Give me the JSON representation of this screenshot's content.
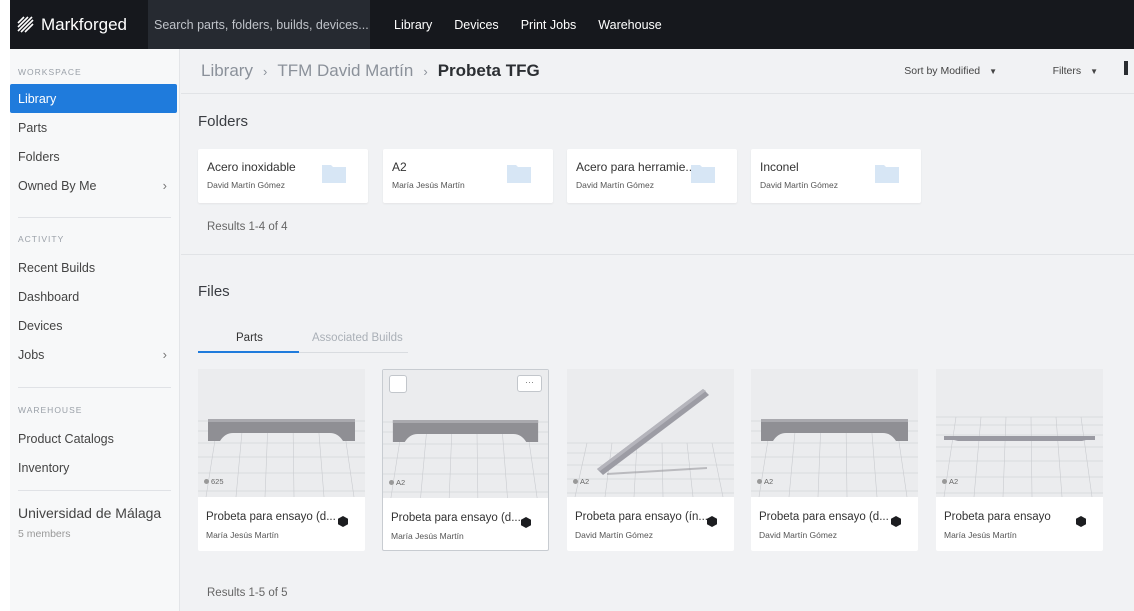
{
  "header": {
    "brand": "Markforged",
    "search_placeholder": "Search parts, folders, builds, devices...",
    "nav": [
      "Library",
      "Devices",
      "Print Jobs",
      "Warehouse"
    ]
  },
  "sidebar": {
    "workspace_heading": "WORKSPACE",
    "workspace_items": [
      "Library",
      "Parts",
      "Folders",
      "Owned By Me"
    ],
    "activity_heading": "ACTIVITY",
    "activity_items": [
      "Recent Builds",
      "Dashboard",
      "Devices",
      "Jobs"
    ],
    "warehouse_heading": "WAREHOUSE",
    "warehouse_items": [
      "Product Catalogs",
      "Inventory"
    ],
    "org_name": "Universidad de Málaga",
    "org_members": "5 members"
  },
  "breadcrumb": [
    "Library",
    "TFM David Martín",
    "Probeta TFG"
  ],
  "toolbar": {
    "sort_label": "Sort by Modified",
    "filters_label": "Filters"
  },
  "folders": {
    "title": "Folders",
    "items": [
      {
        "name": "Acero inoxidable",
        "owner": "David Martín Gómez"
      },
      {
        "name": "A2",
        "owner": "María Jesús Martín"
      },
      {
        "name": "Acero para herramie...",
        "owner": "David Martín Gómez"
      },
      {
        "name": "Inconel",
        "owner": "David Martín Gómez"
      }
    ],
    "results": "Results 1-4 of 4"
  },
  "files": {
    "title": "Files",
    "tabs": [
      "Parts",
      "Associated Builds"
    ],
    "parts": [
      {
        "name": "Probeta para ensayo (d...",
        "owner": "María Jesús Martín",
        "material": "625"
      },
      {
        "name": "Probeta para ensayo (d...",
        "owner": "María Jesús Martín",
        "material": "A2"
      },
      {
        "name": "Probeta para ensayo (ín...",
        "owner": "David Martín Gómez",
        "material": "A2"
      },
      {
        "name": "Probeta para ensayo (d...",
        "owner": "David Martín Gómez",
        "material": "A2"
      },
      {
        "name": "Probeta para ensayo",
        "owner": "María Jesús Martín",
        "material": "A2"
      }
    ],
    "more_label": "···",
    "results": "Results 1-5 of 5"
  },
  "colors": {
    "accent": "#1f7bdc",
    "topbar": "#16181d",
    "folder_icon": "#d7e6f5"
  }
}
